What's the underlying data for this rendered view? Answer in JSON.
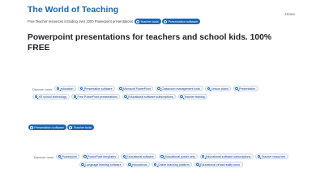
{
  "header": {
    "title": "The World of Teaching",
    "subtitle": "Free Teacher resources including over 1000 Powerpoint presentations",
    "tags": [
      "Teacher tools",
      "Presentation software"
    ],
    "nav": {
      "home": "Home"
    }
  },
  "headline": "Powerpoint presentations for teachers and school kids. 100% FREE",
  "discover1": {
    "label": "Discover more",
    "items": [
      "education",
      "Presentation software",
      "Microsoft PowerPoint",
      "Classroom management tools",
      "Lesson plans",
      "Presentation",
      "XR school technology",
      "Free PowerPoint presentations",
      "Educational software subscriptions",
      "Teacher training"
    ]
  },
  "tags2": [
    "Presentation software",
    "Teacher tools"
  ],
  "discover2": {
    "label": "Discover more",
    "items": [
      "Powerpoint",
      "PowerPoint templates",
      "Educational software",
      "Educational poster sets",
      "Educational software subscriptions",
      "Teacher resources",
      "Language learning software",
      "educational",
      "Online teaching platform",
      "Educational virtual reality tours"
    ]
  },
  "colors": {
    "accent": "#1a66b5",
    "text": "#202124",
    "chip_border": "#c7d4e6"
  }
}
